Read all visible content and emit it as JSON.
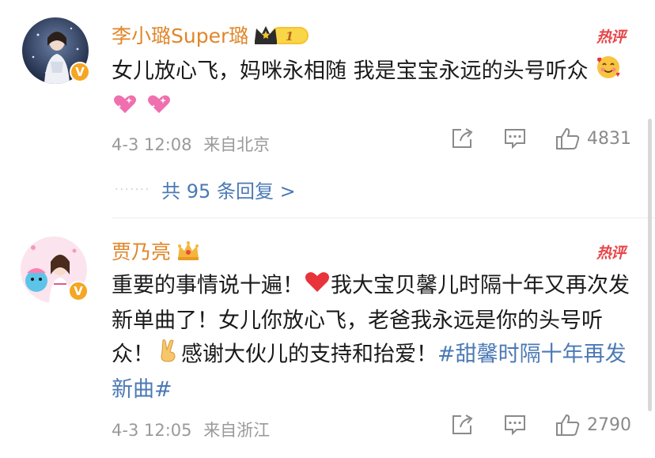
{
  "comments": [
    {
      "username": "李小璐Super璐",
      "badge_level": "1",
      "hot_label": "热评",
      "text": "女儿放心飞，妈咪永相随 我是宝宝永远的头号听众",
      "timestamp": "4-3 12:08",
      "location": "来自北京",
      "like_count": "4831",
      "replies_label": "共 95 条回复 >"
    },
    {
      "username": "贾乃亮",
      "hot_label": "热评",
      "text_part1": "重要的事情说十遍！",
      "text_part2": "我大宝贝馨儿时隔十年又再次发新单曲了！女儿你放心飞，老爸我永远是你的头号听众！",
      "text_part3": "感谢大伙儿的支持和抬爱！",
      "hashtag": "#甜馨时隔十年再发新曲#",
      "timestamp": "4-3 12:05",
      "location": "来自浙江",
      "like_count": "2790"
    }
  ],
  "colors": {
    "username": "#e0862a",
    "hot": "#e8464a",
    "link": "#4b79b5",
    "meta": "#9a9a9a"
  },
  "icons": [
    "share-icon",
    "comment-icon",
    "like-icon",
    "verified-badge-icon",
    "crown-icon"
  ]
}
